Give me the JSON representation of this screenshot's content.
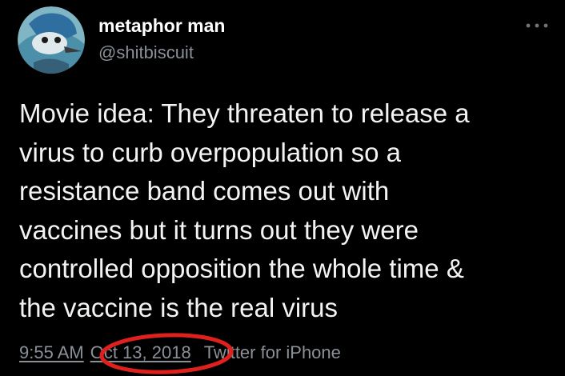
{
  "tweet": {
    "display_name": "metaphor man",
    "handle": "@shitbiscuit",
    "more_icon": "more-horizontal-icon",
    "body_lines": [
      "Movie idea: They threaten to release a",
      "virus to curb overpopulation so a",
      "resistance band comes out with",
      "vaccines but it turns out they were",
      "controlled opposition the whole time &",
      "the vaccine is the real virus"
    ],
    "time": "9:55 AM",
    "date": "Oct 13, 2018",
    "source": "Twitter for iPhone"
  },
  "colors": {
    "background": "#000000",
    "text": "#e7e9ea",
    "secondary_text": "#8b9097",
    "annotation_circle": "#e0201c"
  }
}
